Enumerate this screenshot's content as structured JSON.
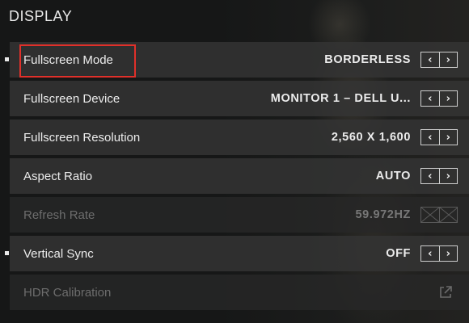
{
  "section": {
    "title": "DISPLAY"
  },
  "settings": [
    {
      "label": "Fullscreen Mode",
      "value": "BORDERLESS",
      "enabled": true,
      "bullet": true
    },
    {
      "label": "Fullscreen Device",
      "value": "MONITOR 1 – DELL U...",
      "enabled": true,
      "bullet": false
    },
    {
      "label": "Fullscreen Resolution",
      "value": "2,560 X 1,600",
      "enabled": true,
      "bullet": false
    },
    {
      "label": "Aspect Ratio",
      "value": "AUTO",
      "enabled": true,
      "bullet": false
    },
    {
      "label": "Refresh Rate",
      "value": "59.972HZ",
      "enabled": false,
      "bullet": false
    },
    {
      "label": "Vertical Sync",
      "value": "OFF",
      "enabled": true,
      "bullet": true
    },
    {
      "label": "HDR Calibration",
      "value": "",
      "enabled": false,
      "bullet": false
    }
  ],
  "icons": {
    "prev": "‹",
    "next": "›",
    "external": "external-link-icon"
  },
  "colors": {
    "highlight": "#e0302a",
    "row_bg": "#343434",
    "text": "#ececec",
    "disabled_text": "#6d6d6d"
  }
}
